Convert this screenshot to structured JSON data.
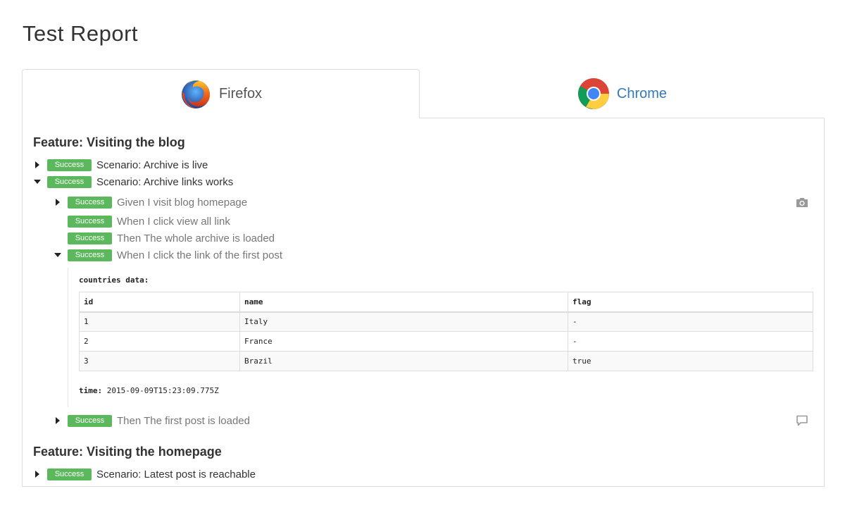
{
  "page_title": "Test Report",
  "tabs": [
    {
      "label": "Firefox",
      "icon": "firefox-icon",
      "active": true
    },
    {
      "label": "Chrome",
      "icon": "chrome-icon",
      "active": false
    }
  ],
  "colors": {
    "success": "#5cb85c",
    "link": "#337ab7",
    "border": "#dddddd"
  },
  "features": [
    {
      "title": "Feature: Visiting the blog",
      "scenarios": [
        {
          "badge": "Success",
          "text": "Scenario: Archive is live",
          "expanded": false
        },
        {
          "badge": "Success",
          "text": "Scenario: Archive links works",
          "expanded": true,
          "steps": [
            {
              "badge": "Success",
              "text": "Given I visit blog homepage",
              "expandable": true,
              "icon": "camera-icon"
            },
            {
              "badge": "Success",
              "text": "When I click view all link",
              "expandable": false
            },
            {
              "badge": "Success",
              "text": "Then The whole archive is loaded",
              "expandable": false
            },
            {
              "badge": "Success",
              "text": "When I click the link of the first post",
              "expandable": true,
              "expanded": true
            },
            {
              "badge": "Success",
              "text": "Then The first post is loaded",
              "expandable": true,
              "icon": "comment-icon"
            }
          ]
        }
      ]
    },
    {
      "title": "Feature: Visiting the homepage",
      "scenarios": [
        {
          "badge": "Success",
          "text": "Scenario: Latest post is reachable",
          "expanded": false
        }
      ]
    }
  ],
  "step_data": {
    "label": "countries data:",
    "columns": [
      "id",
      "name",
      "flag"
    ],
    "rows": [
      [
        "1",
        "Italy",
        "-"
      ],
      [
        "2",
        "France",
        "-"
      ],
      [
        "3",
        "Brazil",
        "true"
      ]
    ],
    "time_label": "time:",
    "time_value": "2015-09-09T15:23:09.775Z"
  }
}
